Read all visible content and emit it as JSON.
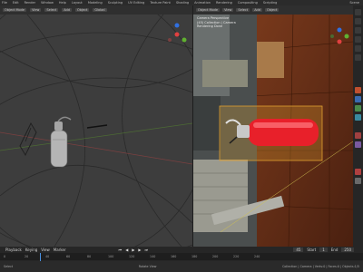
{
  "menubar": {
    "items": [
      "File",
      "Edit",
      "Render",
      "Window",
      "Help",
      "Layout",
      "Modeling",
      "Sculpting",
      "UV Editing",
      "Texture Paint",
      "Shading",
      "Animation",
      "Rendering",
      "Compositing",
      "Scripting"
    ],
    "scene_label": "Scene"
  },
  "left_view": {
    "mode": "Object Mode",
    "view": "View",
    "select": "Select",
    "add": "Add",
    "object": "Object",
    "transform": "Global"
  },
  "right_view": {
    "mode": "Object Mode",
    "view": "View",
    "select": "Select",
    "add": "Add",
    "object": "Object",
    "cam_info": [
      "Camera Perspective",
      "(45) Collection | Camera",
      "Rendering Done"
    ]
  },
  "timeline": {
    "playback": "Playback",
    "keying": "Keying",
    "view": "View",
    "marker": "Marker",
    "current_frame": "45",
    "start_label": "Start",
    "start": "1",
    "end_label": "End",
    "end": "250",
    "ticks": [
      "0",
      "20",
      "40",
      "60",
      "80",
      "100",
      "120",
      "140",
      "160",
      "180",
      "200",
      "220",
      "240"
    ]
  },
  "statusbar": {
    "left": "Select",
    "mid": "Rotate View",
    "right": "Collection | Camera | Verts:0 | Faces:0 | Objects:1/5"
  },
  "colors": {
    "extinguisher": "#e8202a",
    "selection": "#e0a030",
    "axis_x": "#e04040",
    "axis_y": "#60b030",
    "axis_z": "#3070e0"
  }
}
